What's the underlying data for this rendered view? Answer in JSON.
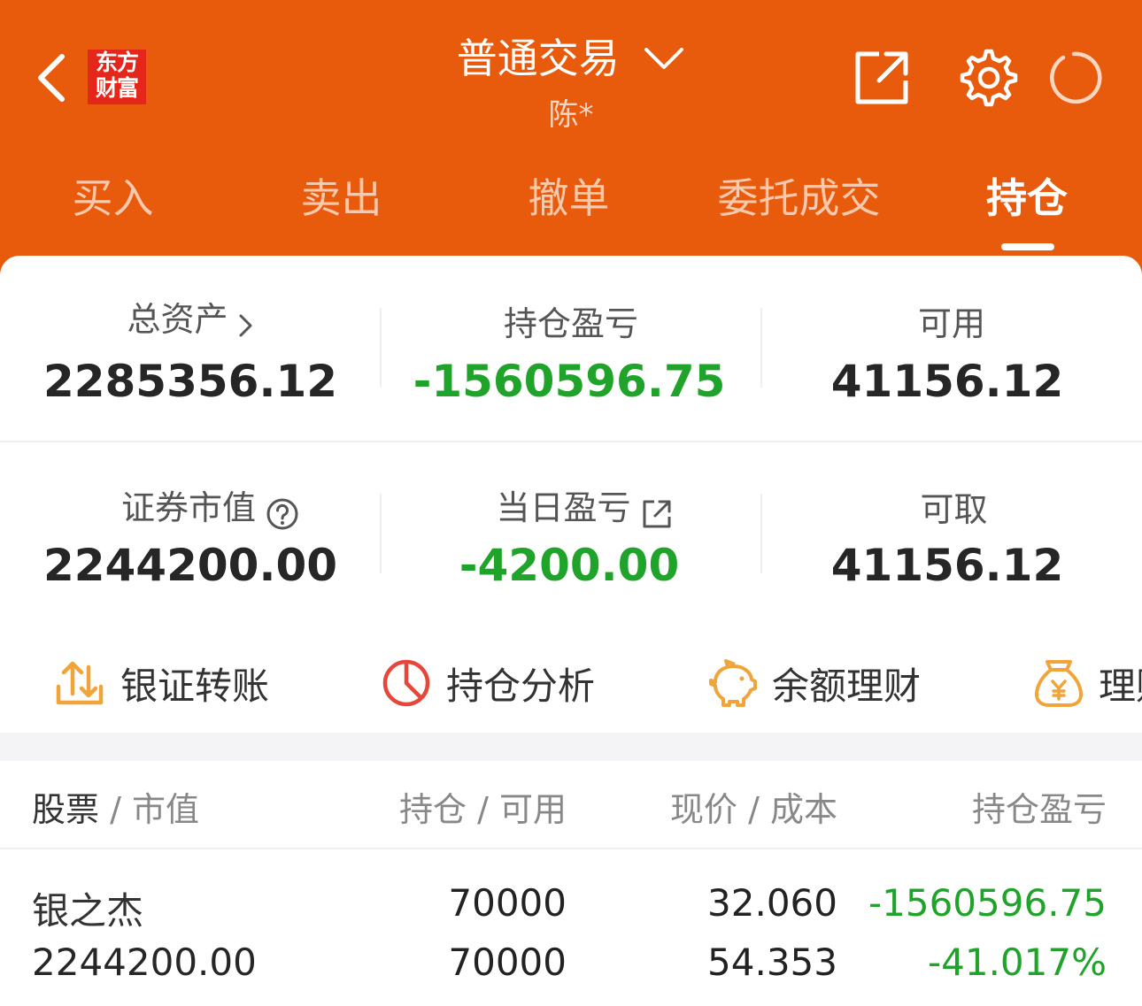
{
  "header": {
    "logo_line1": "东方",
    "logo_line2": "财富",
    "title": "普通交易",
    "account_name": "陈*"
  },
  "tabs": [
    {
      "label": "买入"
    },
    {
      "label": "卖出"
    },
    {
      "label": "撤单"
    },
    {
      "label": "委托成交"
    },
    {
      "label": "持仓",
      "active": true
    }
  ],
  "summary": {
    "total_assets_label": "总资产",
    "total_assets": "2285356.12",
    "position_pl_label": "持仓盈亏",
    "position_pl": "-1560596.75",
    "available_label": "可用",
    "available": "41156.12",
    "market_value_label": "证券市值",
    "market_value": "2244200.00",
    "daily_pl_label": "当日盈亏",
    "daily_pl": "-4200.00",
    "withdrawable_label": "可取",
    "withdrawable": "41156.12"
  },
  "quick_actions": [
    {
      "label": "银证转账",
      "icon": "transfer-icon"
    },
    {
      "label": "持仓分析",
      "icon": "pie-chart-icon"
    },
    {
      "label": "余额理财",
      "icon": "piggy-bank-icon"
    },
    {
      "label": "理财",
      "icon": "money-bag-icon"
    }
  ],
  "table": {
    "col1_main": "股票",
    "col1_sub": "市值",
    "col2_main": "持仓",
    "col2_sub": "可用",
    "col3_main": "现价",
    "col3_sub": "成本",
    "col4_main": "持仓盈亏",
    "rows": [
      {
        "name": "银之杰",
        "market_value": "2244200.00",
        "position": "70000",
        "available": "70000",
        "price": "32.060",
        "cost": "54.353",
        "pl": "-1560596.75",
        "pl_pct": "-41.017%"
      }
    ]
  },
  "colors": {
    "brand": "#e85a0c",
    "loss": "#1fa32a",
    "logo_red": "#e5271b",
    "icon_orange": "#f0a43a",
    "icon_red": "#e5473a"
  }
}
